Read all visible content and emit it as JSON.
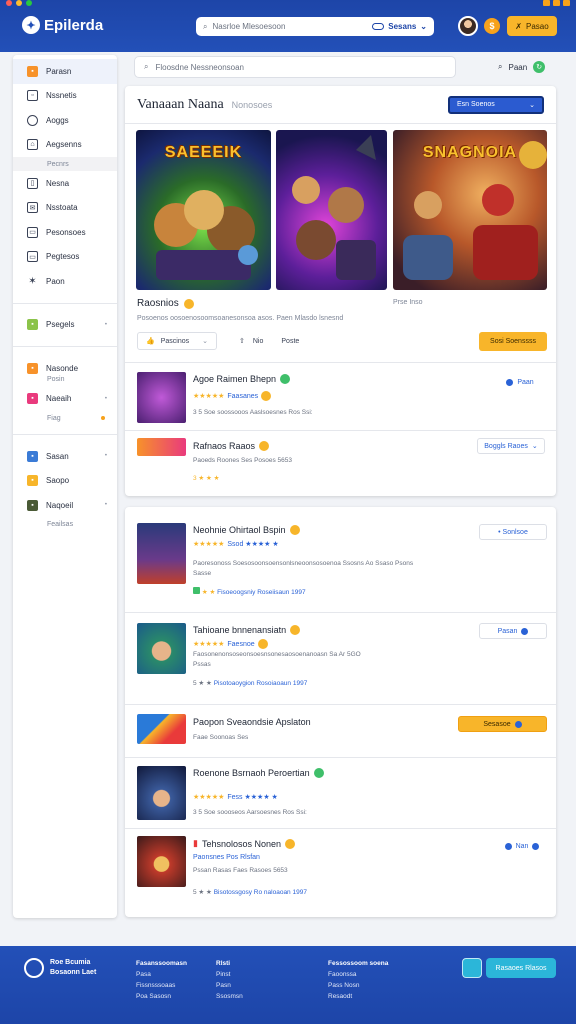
{
  "app": {
    "title": "Epilerda"
  },
  "topbar": {
    "search_placeholder": "Nasrloe Mlesoesoon",
    "search_select": "Sesans",
    "button_label": "Pasao",
    "coin_label": "$"
  },
  "sidebar": {
    "items": [
      {
        "label": "Parasn",
        "icon": "home-icon"
      },
      {
        "label": "Nssnetis",
        "icon": "news-icon"
      },
      {
        "label": "Aoggs",
        "icon": "globe-icon"
      },
      {
        "label": "Aegsenns",
        "icon": "store-icon"
      },
      {
        "label": "Nesna",
        "icon": "book-icon"
      },
      {
        "label": "Nsstoata",
        "icon": "mail-icon"
      },
      {
        "label": "Pesonsoes",
        "icon": "chat-icon"
      },
      {
        "label": "Pegtesos",
        "icon": "folder-icon"
      },
      {
        "label": "Paon",
        "icon": "star-icon"
      }
    ],
    "sub_label": "Pecnrs",
    "groups": [
      {
        "label": "Psegels",
        "chev": "•"
      },
      {
        "label": "Nasonde",
        "sub": "Posin",
        "chev": ""
      },
      {
        "label": "Naeaih",
        "sub": "Fiag",
        "chev": "•"
      },
      {
        "label": "Sasan",
        "chev": "•"
      },
      {
        "label": "Saopo",
        "chev": ""
      },
      {
        "label": "Naqoeil",
        "sub": "Feailsas",
        "chev": "•"
      }
    ]
  },
  "main_search": {
    "placeholder": "Floosdne Nessneonsoan",
    "filter_label": "Paan"
  },
  "featured": {
    "title": "Vanaaan Naana",
    "subtitle": "Nonosoes",
    "dropdown": "Esn Soenos",
    "art_titles": [
      "SAEEEIK",
      "",
      "SNAGNOIA"
    ],
    "name": "Raosnios",
    "date": "Prse Inso",
    "desc": "Posoenos oosoenosoomsoanesonsoa asos. Paen Mlasdo lsnesnd",
    "like_label": "Pascinos",
    "share_label": "Nio",
    "comment_label": "Poste",
    "action_label": "Sosi Soenssss"
  },
  "list1": [
    {
      "title": "Agoe Raimen Bhepn",
      "stars": "★★★★★",
      "sub": "Faasanes",
      "meta": "3  5   Soe soossooos   Aaslsoesnes Ros Ssi:"
    },
    {
      "title": "Rafnaos Raaos",
      "meta_line": "Paoeds Roones    Ses  Posoes  5653",
      "meta": "3  ★  ★  ★",
      "pill": "Boggls Raoes"
    }
  ],
  "list1_pill": "Paan",
  "list2": [
    {
      "title": "Neohnie Ohirtaol Bspin",
      "stars": "★★★★★",
      "sub": "Ssod ★★★★ ★",
      "desc": "Paoresonoss Soesosoonsoensonlsneoonsosoenoa  Ssosns Ao  Ssaso Psons",
      "desc2": "Sasse",
      "meta": "Fisoeoogsniy Roseiisaun  1997",
      "pill": "• Sonlsoe"
    },
    {
      "title": "Tahioane bnnenansiatn",
      "stars": "★★★★★",
      "sub": "Faesnoe",
      "desc": "Faosonenonsoseonsoesnsonesaosoenanoasn  Sa  Ar 5GO",
      "desc2": "Pssas",
      "meta": "Pisotoaoygion Rosoiaoaun  1997",
      "pill": "Pasan"
    },
    {
      "title": "Paopon Sveaondsie Apslaton",
      "sub": "Faae Soonoas      Ses",
      "pill": "Sesasoe"
    },
    {
      "title": "Roenone Bsrnaoh Peroertian",
      "stars": "★★★★★",
      "sub": "Fess ★★★★ ★",
      "meta": "3  5   Soe soooseos   Aarsoesnes Ros Ssi:"
    },
    {
      "title": "Tehsnolosos Nonen",
      "sub": "Paonsnes Pos Rlsfan",
      "meta_line": "Pssan Rasas   Faes   Rasoes  5653",
      "meta": "Bisotossgosy Ro naloaoan  1997",
      "pill": "Nan"
    }
  ],
  "footer": {
    "brand_line1": "Roe Bcumia",
    "brand_line2": "Bosaonn Laet",
    "col1": [
      "Fasanssoomasn",
      "Pasa",
      "Fissnsssoaas",
      "Poa Sasosn"
    ],
    "col2": [
      "Rlsti",
      "Pinst",
      "Pasn",
      "Ssosmsn"
    ],
    "col3": [
      "Fessossoom soena",
      "Faoonssa",
      "Pass Nosn",
      "Resaodt"
    ],
    "button": "Rasaoes Rlasos"
  },
  "colors": {
    "brand": "#2350b8",
    "accent": "#f8b52a",
    "link": "#2a62d6",
    "ok": "#3fbf6a"
  }
}
